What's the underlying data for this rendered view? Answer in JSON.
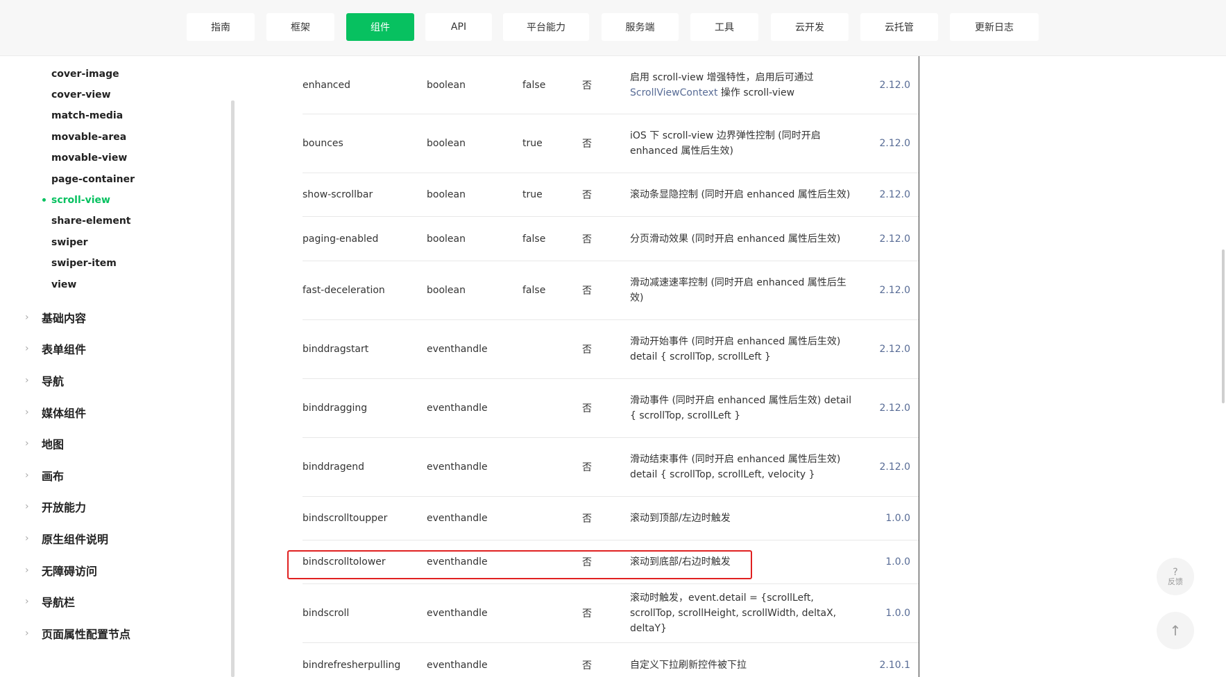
{
  "nav": {
    "tabs": [
      {
        "label": "指南"
      },
      {
        "label": "框架"
      },
      {
        "label": "组件",
        "active": true
      },
      {
        "label": "API"
      },
      {
        "label": "平台能力"
      },
      {
        "label": "服务端"
      },
      {
        "label": "工具"
      },
      {
        "label": "云开发"
      },
      {
        "label": "云托管"
      },
      {
        "label": "更新日志"
      }
    ]
  },
  "sidebar": {
    "sub_items": [
      "cover-image",
      "cover-view",
      "match-media",
      "movable-area",
      "movable-view",
      "page-container",
      "scroll-view",
      "share-element",
      "swiper",
      "swiper-item",
      "view"
    ],
    "active_item": "scroll-view",
    "categories": [
      "基础内容",
      "表单组件",
      "导航",
      "媒体组件",
      "地图",
      "画布",
      "开放能力",
      "原生组件说明",
      "无障碍访问",
      "导航栏",
      "页面属性配置节点"
    ]
  },
  "table": {
    "rows": [
      {
        "name": "enhanced",
        "type": "boolean",
        "default": "false",
        "required": "否",
        "desc_pre": "启用 scroll-view 增强特性，启用后可通过 ",
        "desc_link": "ScrollViewContext",
        "desc_post": " 操作 scroll-view",
        "version": "2.12.0"
      },
      {
        "name": "bounces",
        "type": "boolean",
        "default": "true",
        "required": "否",
        "desc": "iOS 下 scroll-view 边界弹性控制 (同时开启 enhanced 属性后生效)",
        "version": "2.12.0"
      },
      {
        "name": "show-scrollbar",
        "type": "boolean",
        "default": "true",
        "required": "否",
        "desc": "滚动条显隐控制 (同时开启 enhanced 属性后生效)",
        "version": "2.12.0"
      },
      {
        "name": "paging-enabled",
        "type": "boolean",
        "default": "false",
        "required": "否",
        "desc": "分页滑动效果 (同时开启 enhanced 属性后生效)",
        "version": "2.12.0"
      },
      {
        "name": "fast-deceleration",
        "type": "boolean",
        "default": "false",
        "required": "否",
        "desc": "滑动减速速率控制 (同时开启 enhanced 属性后生效)",
        "version": "2.12.0"
      },
      {
        "name": "binddragstart",
        "type": "eventhandle",
        "default": "",
        "required": "否",
        "desc": "滑动开始事件 (同时开启 enhanced 属性后生效) detail { scrollTop, scrollLeft }",
        "version": "2.12.0"
      },
      {
        "name": "binddragging",
        "type": "eventhandle",
        "default": "",
        "required": "否",
        "desc": "滑动事件 (同时开启 enhanced 属性后生效) detail { scrollTop, scrollLeft }",
        "version": "2.12.0"
      },
      {
        "name": "binddragend",
        "type": "eventhandle",
        "default": "",
        "required": "否",
        "desc": "滑动结束事件 (同时开启 enhanced 属性后生效) detail { scrollTop, scrollLeft, velocity }",
        "version": "2.12.0"
      },
      {
        "name": "bindscrolltoupper",
        "type": "eventhandle",
        "default": "",
        "required": "否",
        "desc": "滚动到顶部/左边时触发",
        "version": "1.0.0"
      },
      {
        "name": "bindscrolltolower",
        "type": "eventhandle",
        "default": "",
        "required": "否",
        "desc": "滚动到底部/右边时触发",
        "version": "1.0.0",
        "highlighted": true
      },
      {
        "name": "bindscroll",
        "type": "eventhandle",
        "default": "",
        "required": "否",
        "desc": "滚动时触发，event.detail = {scrollLeft, scrollTop, scrollHeight, scrollWidth, deltaX, deltaY}",
        "version": "1.0.0"
      },
      {
        "name": "bindrefresherpulling",
        "type": "eventhandle",
        "default": "",
        "required": "否",
        "desc": "自定义下拉刷新控件被下拉",
        "version": "2.10.1"
      }
    ]
  },
  "feedback": {
    "icon": "question-mark-icon",
    "label": "反馈"
  },
  "back_to_top": {
    "icon": "arrow-up-icon"
  }
}
